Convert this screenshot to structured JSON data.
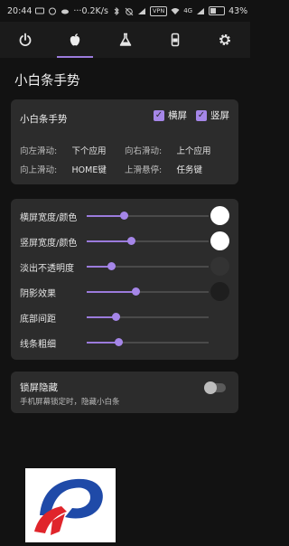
{
  "statusbar": {
    "time": "20:44",
    "speed": "0.2K/s",
    "network": "4G",
    "battery": "43%",
    "vpn": "VPN"
  },
  "tabs": [
    {
      "icon": "power-icon",
      "active": false
    },
    {
      "icon": "apple-icon",
      "active": true
    },
    {
      "icon": "flask-icon",
      "active": false
    },
    {
      "icon": "phone-icon",
      "active": false
    },
    {
      "icon": "gear-icon",
      "active": false
    }
  ],
  "page_title": "小白条手势",
  "gesture_card": {
    "title": "小白条手势",
    "landscape_label": "横屏",
    "portrait_label": "竖屏",
    "landscape_checked": true,
    "portrait_checked": true,
    "rows": [
      {
        "l1": "向左滑动:",
        "v1": "下个应用",
        "l2": "向右滑动:",
        "v2": "上个应用"
      },
      {
        "l1": "向上滑动:",
        "v1": "HOME键",
        "l2": "上滑悬停:",
        "v2": "任务键"
      }
    ]
  },
  "appearance_card": {
    "sliders": [
      {
        "label": "横屏宽度/颜色",
        "value": 0.3,
        "swatch": "#ffffff"
      },
      {
        "label": "竖屏宽度/颜色",
        "value": 0.36,
        "swatch": "#ffffff"
      },
      {
        "label": "淡出不透明度",
        "value": 0.2,
        "swatch": "#333333"
      },
      {
        "label": "阴影效果",
        "value": 0.4,
        "swatch": "#1e1e1e"
      },
      {
        "label": "底部间距",
        "value": 0.24,
        "swatch": null
      },
      {
        "label": "线条粗细",
        "value": 0.26,
        "swatch": null
      }
    ]
  },
  "lock_card": {
    "title": "锁屏隐藏",
    "subtitle": "手机屏幕锁定时，隐藏小白条",
    "enabled": false
  },
  "colors": {
    "accent": "#9b7bdc",
    "background": "#121212",
    "card": "#2c2c2c"
  }
}
